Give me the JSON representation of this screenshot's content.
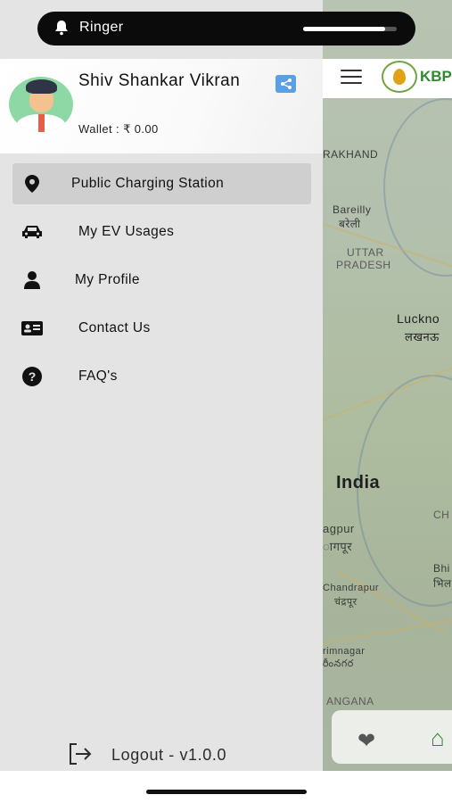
{
  "status": {
    "ringer_label": "Ringer",
    "volume_level": 0.88
  },
  "header": {
    "logo_text": "KBP"
  },
  "map": {
    "labels": {
      "rakhand": "RAKHAND",
      "bareilly": "Bareilly",
      "bareilly_hi": "बरेली",
      "uttar": "UTTAR",
      "pradesh": "PRADESH",
      "lucknow": "Luckno",
      "lucknow_hi": "लखनऊ",
      "india": "India",
      "ch": "CH",
      "agpur": "agpur",
      "agpur_hi": "ागपूर",
      "bhi": "Bhi",
      "bhi_hi": "भिल",
      "chandrapur": "Chandrapur",
      "chandrapur_hi": "चंद्रपूर",
      "rimnagar": "rimnagar",
      "rimnagar_te": "రీంనగర",
      "angana": "ANGANA"
    }
  },
  "profile": {
    "name": "Shiv Shankar  Vikran",
    "wallet": "Wallet : ₹ 0.00"
  },
  "menu": {
    "items": [
      {
        "label": "Public Charging Station",
        "icon": "map-pin-icon"
      },
      {
        "label": "My EV Usages",
        "icon": "car-icon"
      },
      {
        "label": "My Profile",
        "icon": "user-icon"
      },
      {
        "label": "Contact Us",
        "icon": "contact-card-icon"
      },
      {
        "label": "FAQ's",
        "icon": "question-circle-icon"
      }
    ],
    "active_index": 0
  },
  "footer": {
    "logout_label": "Logout - v1.0.0"
  },
  "colors": {
    "drawer_bg": "#e4e4e4",
    "active_item_bg": "#cfcfcf",
    "share_blue": "#5aa0e6",
    "brand_green": "#2f8a2f"
  }
}
